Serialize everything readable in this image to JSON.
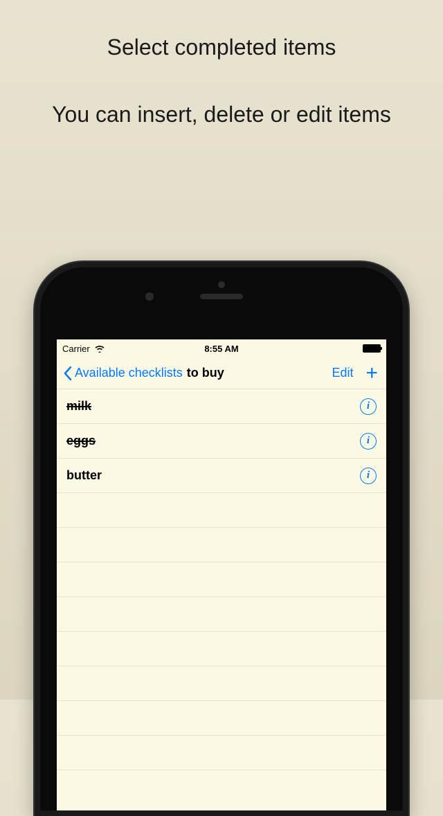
{
  "promo": {
    "line1": "Select completed items",
    "line2": "You can insert, delete or edit items"
  },
  "status": {
    "carrier": "Carrier",
    "time": "8:55 AM"
  },
  "nav": {
    "back_label": "Available checklists",
    "title": "to buy",
    "edit_label": "Edit",
    "add_label": "+"
  },
  "items": [
    {
      "label": "milk",
      "done": true
    },
    {
      "label": "eggs",
      "done": true
    },
    {
      "label": "butter",
      "done": false
    }
  ],
  "info_glyph": "i"
}
